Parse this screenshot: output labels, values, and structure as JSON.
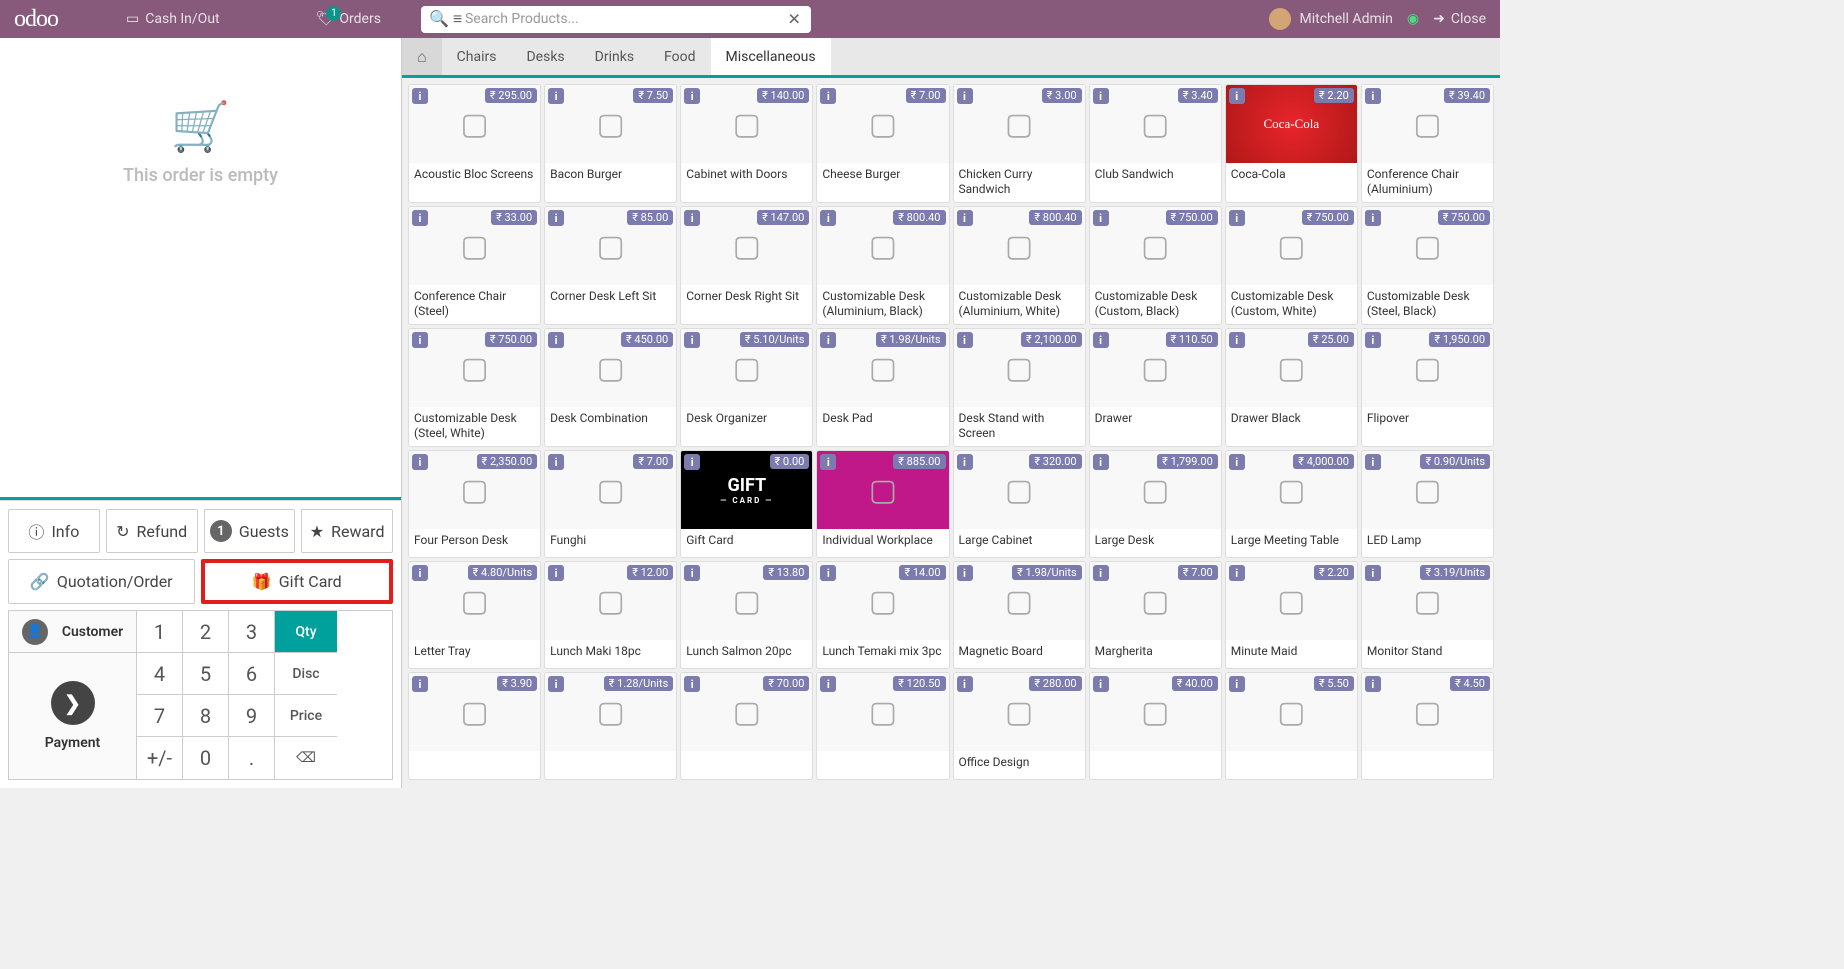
{
  "header": {
    "logo": "odoo",
    "cashInOut": "Cash In/Out",
    "orders": "Orders",
    "ordersBadge": "1",
    "searchPlaceholder": "Search Products...",
    "userName": "Mitchell Admin",
    "close": "Close"
  },
  "cart": {
    "emptyText": "This order is empty"
  },
  "actions": {
    "info": "Info",
    "refund": "Refund",
    "guestsCount": "1",
    "guests": "Guests",
    "reward": "Reward",
    "quotation": "Quotation/Order",
    "giftCard": "Gift Card",
    "customer": "Customer",
    "payment": "Payment",
    "qty": "Qty",
    "disc": "Disc",
    "price": "Price"
  },
  "keypad": [
    "1",
    "2",
    "3",
    "4",
    "5",
    "6",
    "7",
    "8",
    "9",
    "+/-",
    "0",
    "."
  ],
  "categories": [
    "Chairs",
    "Desks",
    "Drinks",
    "Food",
    "Miscellaneous"
  ],
  "products": [
    {
      "name": "Acoustic Bloc Screens",
      "price": "₹ 295.00"
    },
    {
      "name": "Bacon Burger",
      "price": "₹ 7.50"
    },
    {
      "name": "Cabinet with Doors",
      "price": "₹ 140.00"
    },
    {
      "name": "Cheese Burger",
      "price": "₹ 7.00"
    },
    {
      "name": "Chicken Curry Sandwich",
      "price": "₹ 3.00"
    },
    {
      "name": "Club Sandwich",
      "price": "₹ 3.40"
    },
    {
      "name": "Coca-Cola",
      "price": "₹ 2.20"
    },
    {
      "name": "Conference Chair (Aluminium)",
      "price": "₹ 39.40"
    },
    {
      "name": "Conference Chair (Steel)",
      "price": "₹ 33.00"
    },
    {
      "name": "Corner Desk Left Sit",
      "price": "₹ 85.00"
    },
    {
      "name": "Corner Desk Right Sit",
      "price": "₹ 147.00"
    },
    {
      "name": "Customizable Desk (Aluminium, Black)",
      "price": "₹ 800.40"
    },
    {
      "name": "Customizable Desk (Aluminium, White)",
      "price": "₹ 800.40"
    },
    {
      "name": "Customizable Desk (Custom, Black)",
      "price": "₹ 750.00"
    },
    {
      "name": "Customizable Desk (Custom, White)",
      "price": "₹ 750.00"
    },
    {
      "name": "Customizable Desk (Steel, Black)",
      "price": "₹ 750.00"
    },
    {
      "name": "Customizable Desk (Steel, White)",
      "price": "₹ 750.00"
    },
    {
      "name": "Desk Combination",
      "price": "₹ 450.00"
    },
    {
      "name": "Desk Organizer",
      "price": "₹ 5.10/Units"
    },
    {
      "name": "Desk Pad",
      "price": "₹ 1.98/Units"
    },
    {
      "name": "Desk Stand with Screen",
      "price": "₹ 2,100.00"
    },
    {
      "name": "Drawer",
      "price": "₹ 110.50"
    },
    {
      "name": "Drawer Black",
      "price": "₹ 25.00"
    },
    {
      "name": "Flipover",
      "price": "₹ 1,950.00"
    },
    {
      "name": "Four Person Desk",
      "price": "₹ 2,350.00"
    },
    {
      "name": "Funghi",
      "price": "₹ 7.00"
    },
    {
      "name": "Gift Card",
      "price": "₹ 0.00"
    },
    {
      "name": "Individual Workplace",
      "price": "₹ 885.00"
    },
    {
      "name": "Large Cabinet",
      "price": "₹ 320.00"
    },
    {
      "name": "Large Desk",
      "price": "₹ 1,799.00"
    },
    {
      "name": "Large Meeting Table",
      "price": "₹ 4,000.00"
    },
    {
      "name": "LED Lamp",
      "price": "₹ 0.90/Units"
    },
    {
      "name": "Letter Tray",
      "price": "₹ 4.80/Units"
    },
    {
      "name": "Lunch Maki 18pc",
      "price": "₹ 12.00"
    },
    {
      "name": "Lunch Salmon 20pc",
      "price": "₹ 13.80"
    },
    {
      "name": "Lunch Temaki mix 3pc",
      "price": "₹ 14.00"
    },
    {
      "name": "Magnetic Board",
      "price": "₹ 1.98/Units"
    },
    {
      "name": "Margherita",
      "price": "₹ 7.00"
    },
    {
      "name": "Minute Maid",
      "price": "₹ 2.20"
    },
    {
      "name": "Monitor Stand",
      "price": "₹ 3.19/Units"
    },
    {
      "name": "",
      "price": "₹ 3.90"
    },
    {
      "name": "",
      "price": "₹ 1.28/Units"
    },
    {
      "name": "",
      "price": "₹ 70.00"
    },
    {
      "name": "",
      "price": "₹ 120.50"
    },
    {
      "name": "Office Design",
      "price": "₹ 280.00"
    },
    {
      "name": "",
      "price": "₹ 40.00"
    },
    {
      "name": "",
      "price": "₹ 5.50"
    },
    {
      "name": "",
      "price": "₹ 4.50"
    }
  ]
}
